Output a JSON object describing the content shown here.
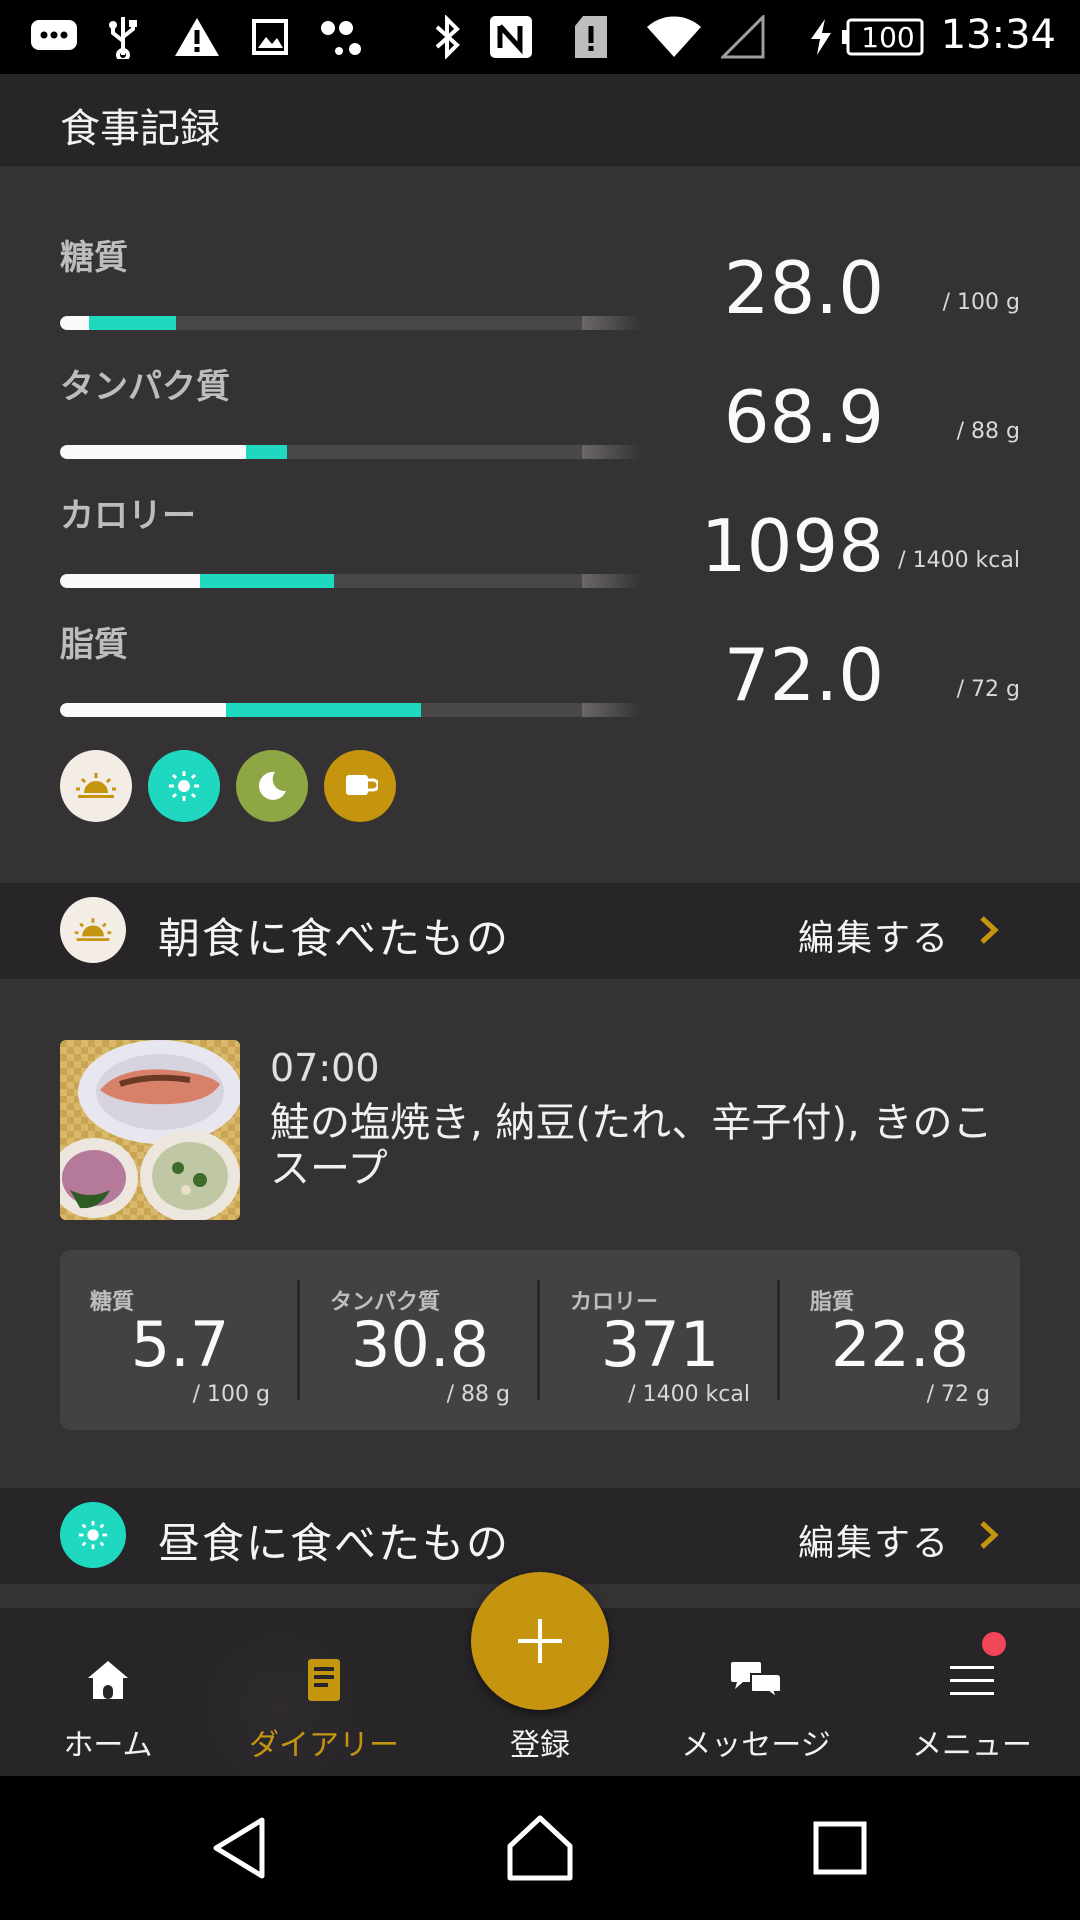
{
  "status_bar": {
    "time": "13:34",
    "battery": "100",
    "icons": [
      "chat-icon",
      "usb-icon",
      "warning-icon",
      "image-icon",
      "assistant-icon",
      "bluetooth-icon",
      "nfc-icon",
      "sim-alert-icon",
      "wifi-icon",
      "signal-icon",
      "charging-icon",
      "battery-icon"
    ]
  },
  "app_bar": {
    "title": "食事記録"
  },
  "nutrients": [
    {
      "label": "糖質",
      "value": "28.0",
      "max": "/ 100 g",
      "white_fraction": 0.05,
      "teal_fraction": 0.2
    },
    {
      "label": "タンパク質",
      "value": "68.9",
      "max": "/ 88 g",
      "white_fraction": 0.32,
      "teal_fraction": 0.39
    },
    {
      "label": "カロリー",
      "value": "1098",
      "max": "/ 1400 kcal",
      "white_fraction": 0.24,
      "teal_fraction": 0.47
    },
    {
      "label": "脂質",
      "value": "72.0",
      "max": "/ 72 g",
      "white_fraction": 0.285,
      "teal_fraction": 0.62
    }
  ],
  "meal_filters": [
    "breakfast-icon",
    "lunch-icon",
    "dinner-icon",
    "snack-icon"
  ],
  "breakfast": {
    "title": "朝食に食べたもの",
    "edit_label": "編集する",
    "time": "07:00",
    "description": "鮭の塩焼き, 納豆(たれ、辛子付), きのこスープ",
    "summary": [
      {
        "label": "糖質",
        "value": "5.7",
        "max": "/ 100 g"
      },
      {
        "label": "タンパク質",
        "value": "30.8",
        "max": "/ 88 g"
      },
      {
        "label": "カロリー",
        "value": "371",
        "max": "/ 1400 kcal"
      },
      {
        "label": "脂質",
        "value": "22.8",
        "max": "/ 72 g"
      }
    ]
  },
  "lunch": {
    "title": "昼食に食べたもの",
    "edit_label": "編集する"
  },
  "bottom_nav": {
    "items": [
      {
        "label": "ホーム",
        "icon": "home-icon"
      },
      {
        "label": "ダイアリー",
        "icon": "diary-icon"
      },
      {
        "label": "登録",
        "icon": "plus-icon"
      },
      {
        "label": "メッセージ",
        "icon": "message-icon"
      },
      {
        "label": "メニュー",
        "icon": "menu-icon"
      }
    ],
    "active": "ダイアリー"
  },
  "colors": {
    "accent": "#c6950f",
    "teal": "#1fd8c0",
    "breakfast": "#f3ede6",
    "lunch": "#1fd8c0",
    "dinner": "#8fa645",
    "snack": "#c6950f",
    "badge": "#f04657"
  }
}
